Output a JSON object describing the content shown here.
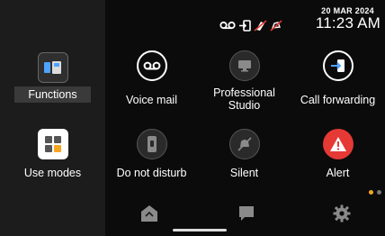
{
  "status": {
    "date": "20 MAR 2024",
    "time": "11:23 AM",
    "icons": [
      "voicemail-icon",
      "call-forward-icon",
      "do-not-disturb-icon",
      "silent-icon"
    ]
  },
  "tiles": [
    {
      "label": "Functions",
      "icon": "phone-functions-icon",
      "selected": true
    },
    {
      "label": "Voice mail",
      "icon": "voicemail-icon"
    },
    {
      "label": "Professional Studio",
      "icon": "monitor-icon"
    },
    {
      "label": "Call forwarding",
      "icon": "call-forward-icon"
    },
    {
      "label": "Use modes",
      "icon": "grid-icon"
    },
    {
      "label": "Do not disturb",
      "icon": "do-not-disturb-icon"
    },
    {
      "label": "Silent",
      "icon": "bell-off-icon"
    },
    {
      "label": "Alert",
      "icon": "alert-icon"
    }
  ],
  "pagination": {
    "pages": 2,
    "current": 1
  },
  "nav": [
    {
      "icon": "home-icon"
    },
    {
      "icon": "chat-icon"
    },
    {
      "icon": "settings-icon"
    }
  ],
  "colors": {
    "accent": "#f4a623",
    "alert": "#e53935",
    "selected_bg": "#3a3a3a"
  }
}
